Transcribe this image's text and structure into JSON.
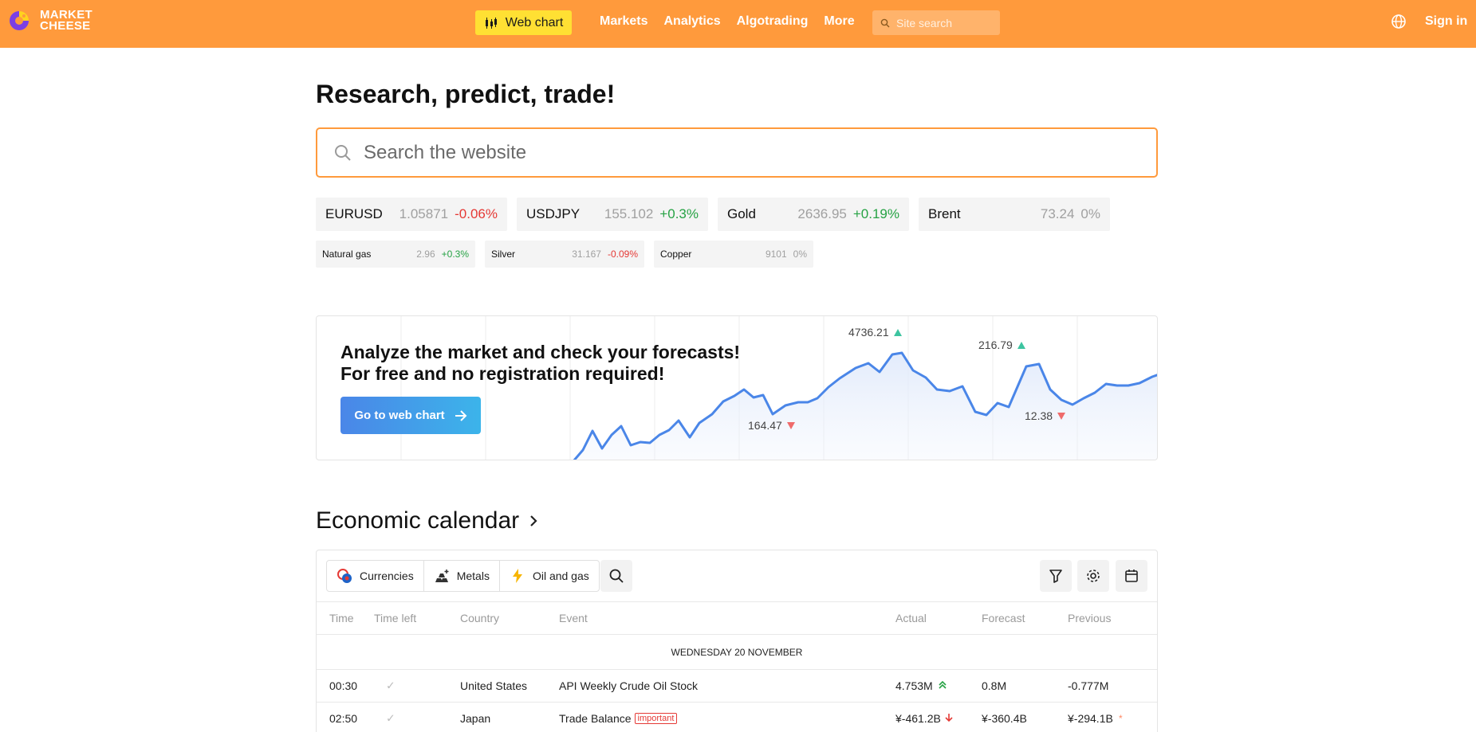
{
  "header": {
    "logo_line1": "MARKET",
    "logo_line2": "CHEESE",
    "webchart_label": "Web chart",
    "nav": [
      "Markets",
      "Analytics",
      "Algotrading",
      "More"
    ],
    "site_search_placeholder": "Site search",
    "signin": "Sign in",
    "colors": {
      "bar": "#ff9a3c",
      "webchart": "#ffe033"
    }
  },
  "hero": {
    "title": "Research, predict, trade!",
    "search_placeholder": "Search the website"
  },
  "quotes_big": [
    {
      "name": "EURUSD",
      "price": "1.05871",
      "change": "-0.06%",
      "dir": "down"
    },
    {
      "name": "USDJPY",
      "price": "155.102",
      "change": "+0.3%",
      "dir": "up"
    },
    {
      "name": "Gold",
      "price": "2636.95",
      "change": "+0.19%",
      "dir": "up"
    },
    {
      "name": "Brent",
      "price": "73.24",
      "change": "0%",
      "dir": "flat"
    }
  ],
  "quotes_small": [
    {
      "name": "Natural gas",
      "price": "2.96",
      "change": "+0.3%",
      "dir": "up"
    },
    {
      "name": "Silver",
      "price": "31.167",
      "change": "-0.09%",
      "dir": "down"
    },
    {
      "name": "Copper",
      "price": "9101",
      "change": "0%",
      "dir": "flat"
    }
  ],
  "promo": {
    "line1": "Analyze the market and check your forecasts!",
    "line2": "For free and no registration required!",
    "button": "Go to web chart",
    "labels": [
      {
        "text": "4736.21",
        "dir": "up"
      },
      {
        "text": "216.79",
        "dir": "up"
      },
      {
        "text": "164.47",
        "dir": "down"
      },
      {
        "text": "12.38",
        "dir": "down"
      }
    ]
  },
  "calendar": {
    "title": "Economic calendar",
    "filters": [
      "Currencies",
      "Metals",
      "Oil and gas"
    ],
    "columns": [
      "Time",
      "Time left",
      "Country",
      "Event",
      "Actual",
      "Forecast",
      "Previous"
    ],
    "day": "Wednesday 20 November",
    "rows": [
      {
        "time": "00:30",
        "country": "United States",
        "event": "API Weekly Crude Oil Stock",
        "important": "",
        "actual": "4.753M",
        "forecast": "0.8M",
        "previous": "-0.777M"
      },
      {
        "time": "02:50",
        "country": "Japan",
        "event": "Trade Balance",
        "important": "important",
        "actual": "¥-461.2B",
        "forecast": "¥-360.4B",
        "previous": "¥-294.1B"
      }
    ]
  }
}
